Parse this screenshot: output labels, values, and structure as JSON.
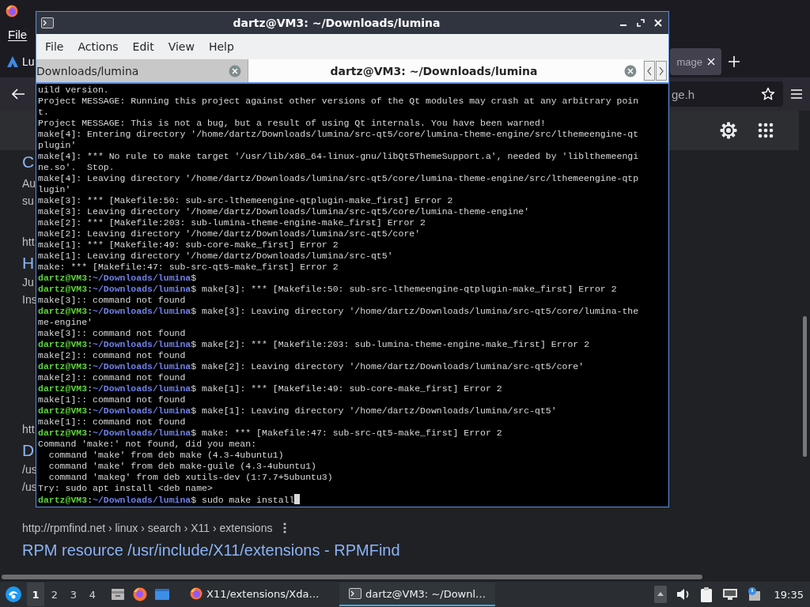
{
  "browser": {
    "menu": [
      "File"
    ],
    "tabs": [
      {
        "label": "Lu",
        "selected": false
      },
      {
        "label": "mage",
        "selected": true
      }
    ],
    "address": {
      "value": "ge.h"
    },
    "results": [
      {
        "kind": "heading",
        "text": "C"
      },
      {
        "kind": "snippet",
        "text": "Au"
      },
      {
        "kind": "snippet",
        "text": "su"
      },
      {
        "kind": "url",
        "text": "htt"
      },
      {
        "kind": "heading",
        "text": "H"
      },
      {
        "kind": "snippet",
        "text": "Ju"
      },
      {
        "kind": "snippet",
        "text": "Ins"
      },
      {
        "kind": "url",
        "text": "htt"
      },
      {
        "kind": "heading",
        "text": "D"
      },
      {
        "kind": "snippet",
        "text": "/us"
      },
      {
        "kind": "snippet",
        "text": "/us"
      }
    ],
    "result_url": "http://rpmfind.net › linux › search › X11 › extensions",
    "result_title": "RPM resource /usr/include/X11/extensions - RPMFind"
  },
  "terminal": {
    "title": "dartz@VM3: ~/Downloads/lumina",
    "menu": [
      "File",
      "Actions",
      "Edit",
      "View",
      "Help"
    ],
    "tabs": [
      {
        "label": "Downloads/lumina",
        "selected": false
      },
      {
        "label": "dartz@VM3: ~/Downloads/lumina",
        "selected": true
      }
    ],
    "cursor": true,
    "lines": [
      {
        "kind": "output",
        "text": "uild version."
      },
      {
        "kind": "output",
        "text": "Project MESSAGE: Running this project against other versions of the Qt modules may crash at any arbitrary poin"
      },
      {
        "kind": "output",
        "text": "t."
      },
      {
        "kind": "output",
        "text": "Project MESSAGE: This is not a bug, but a result of using Qt internals. You have been warned!"
      },
      {
        "kind": "output",
        "text": "make[4]: Entering directory '/home/dartz/Downloads/lumina/src-qt5/core/lumina-theme-engine/src/lthemeengine-qt"
      },
      {
        "kind": "output",
        "text": "plugin'"
      },
      {
        "kind": "output",
        "text": "make[4]: *** No rule to make target '/usr/lib/x86_64-linux-gnu/libQt5ThemeSupport.a', needed by 'liblthemeengi"
      },
      {
        "kind": "output",
        "text": "ne.so'.  Stop."
      },
      {
        "kind": "output",
        "text": "make[4]: Leaving directory '/home/dartz/Downloads/lumina/src-qt5/core/lumina-theme-engine/src/lthemeengine-qtp"
      },
      {
        "kind": "output",
        "text": "lugin'"
      },
      {
        "kind": "output",
        "text": "make[3]: *** [Makefile:50: sub-src-lthemeengine-qtplugin-make_first] Error 2"
      },
      {
        "kind": "output",
        "text": "make[3]: Leaving directory '/home/dartz/Downloads/lumina/src-qt5/core/lumina-theme-engine'"
      },
      {
        "kind": "output",
        "text": "make[2]: *** [Makefile:203: sub-lumina-theme-engine-make_first] Error 2"
      },
      {
        "kind": "output",
        "text": "make[2]: Leaving directory '/home/dartz/Downloads/lumina/src-qt5/core'"
      },
      {
        "kind": "output",
        "text": "make[1]: *** [Makefile:49: sub-core-make_first] Error 2"
      },
      {
        "kind": "output",
        "text": "make[1]: Leaving directory '/home/dartz/Downloads/lumina/src-qt5'"
      },
      {
        "kind": "output",
        "text": "make: *** [Makefile:47: sub-src-qt5-make_first] Error 2"
      },
      {
        "kind": "prompt",
        "user": "dartz@VM3",
        "sep": ":",
        "path": "~/Downloads/lumina",
        "text": "$"
      },
      {
        "kind": "prompt",
        "user": "dartz@VM3",
        "sep": ":",
        "path": "~/Downloads/lumina",
        "text": "$ make[3]: *** [Makefile:50: sub-src-lthemeengine-qtplugin-make_first] Error 2"
      },
      {
        "kind": "output",
        "text": "make[3]:: command not found"
      },
      {
        "kind": "prompt",
        "user": "dartz@VM3",
        "sep": ":",
        "path": "~/Downloads/lumina",
        "text": "$ make[3]: Leaving directory '/home/dartz/Downloads/lumina/src-qt5/core/lumina-the"
      },
      {
        "kind": "output",
        "text": "me-engine'"
      },
      {
        "kind": "output",
        "text": "make[3]:: command not found"
      },
      {
        "kind": "prompt",
        "user": "dartz@VM3",
        "sep": ":",
        "path": "~/Downloads/lumina",
        "text": "$ make[2]: *** [Makefile:203: sub-lumina-theme-engine-make_first] Error 2"
      },
      {
        "kind": "output",
        "text": "make[2]:: command not found"
      },
      {
        "kind": "prompt",
        "user": "dartz@VM3",
        "sep": ":",
        "path": "~/Downloads/lumina",
        "text": "$ make[2]: Leaving directory '/home/dartz/Downloads/lumina/src-qt5/core'"
      },
      {
        "kind": "output",
        "text": "make[2]:: command not found"
      },
      {
        "kind": "prompt",
        "user": "dartz@VM3",
        "sep": ":",
        "path": "~/Downloads/lumina",
        "text": "$ make[1]: *** [Makefile:49: sub-core-make_first] Error 2"
      },
      {
        "kind": "output",
        "text": "make[1]:: command not found"
      },
      {
        "kind": "prompt",
        "user": "dartz@VM3",
        "sep": ":",
        "path": "~/Downloads/lumina",
        "text": "$ make[1]: Leaving directory '/home/dartz/Downloads/lumina/src-qt5'"
      },
      {
        "kind": "output",
        "text": "make[1]:: command not found"
      },
      {
        "kind": "prompt",
        "user": "dartz@VM3",
        "sep": ":",
        "path": "~/Downloads/lumina",
        "text": "$ make: *** [Makefile:47: sub-src-qt5-make_first] Error 2"
      },
      {
        "kind": "output",
        "text": "Command 'make:' not found, did you mean:"
      },
      {
        "kind": "output",
        "text": "  command 'make' from deb make (4.3-4ubuntu1)"
      },
      {
        "kind": "output",
        "text": "  command 'make' from deb make-guile (4.3-4ubuntu1)"
      },
      {
        "kind": "output",
        "text": "  command 'makeg' from deb xutils-dev (1:7.7+5ubuntu3)"
      },
      {
        "kind": "output",
        "text": "Try: sudo apt install <deb name>"
      },
      {
        "kind": "prompt",
        "user": "dartz@VM3",
        "sep": ":",
        "path": "~/Downloads/lumina",
        "text": "$ sudo make install"
      }
    ]
  },
  "taskbar": {
    "workspaces": [
      {
        "label": "1",
        "selected": true
      },
      {
        "label": "2",
        "selected": false
      },
      {
        "label": "3",
        "selected": false
      },
      {
        "label": "4",
        "selected": false
      }
    ],
    "tasks": [
      {
        "kind": "browser",
        "label": "X11/extensions/Xda…",
        "selected": false
      },
      {
        "kind": "terminal",
        "label": "dartz@VM3: ~/Downl…",
        "selected": true
      }
    ],
    "clock": "19:35"
  }
}
